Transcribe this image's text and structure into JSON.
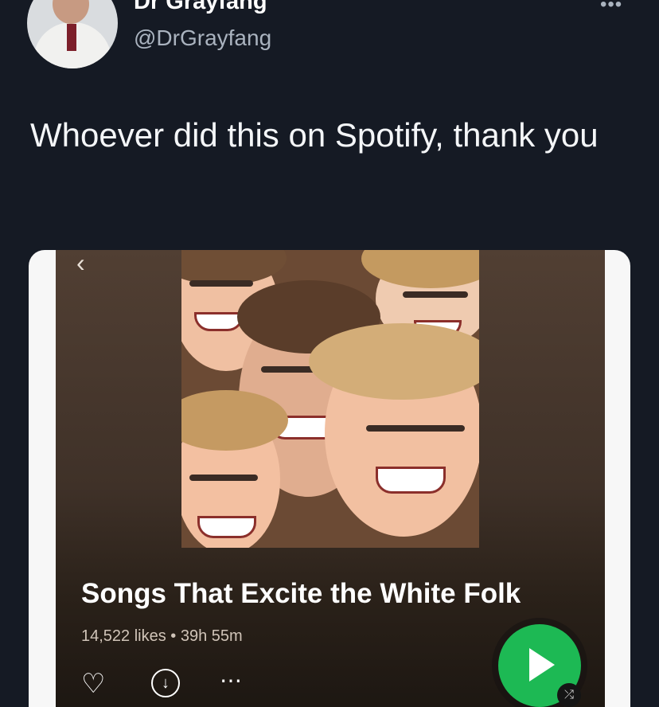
{
  "tweet": {
    "author": "Dr Grayfang",
    "handle": "@DrGrayfang",
    "text": "Whoever did this on Spotify, thank you",
    "more_icon": "more-horizontal-icon"
  },
  "spotify": {
    "back_icon": "chevron-left-icon",
    "playlist_title": "Songs That Excite the White Folk",
    "meta": "14,522 likes • 39h 55m",
    "heart_icon": "heart-icon",
    "download_icon": "download-icon",
    "more_icon": "more-icon",
    "play_icon": "play-icon",
    "shuffle_icon": "shuffle-icon"
  },
  "colors": {
    "background": "#151a24",
    "spotify_green": "#1db954"
  }
}
